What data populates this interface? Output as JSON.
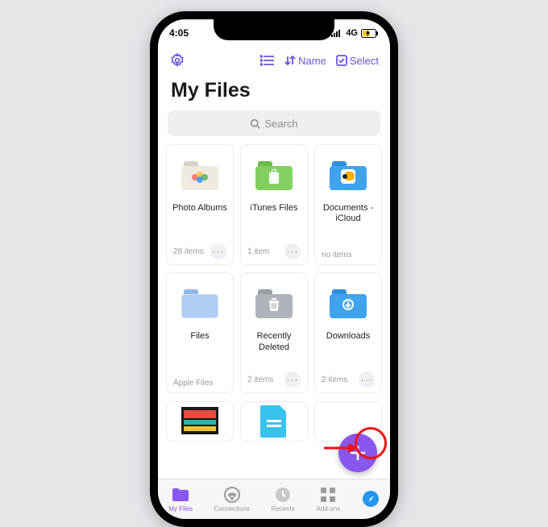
{
  "status": {
    "time": "4:05",
    "network": "4G"
  },
  "toolbar": {
    "sort_label": "Name",
    "select_label": "Select"
  },
  "header": {
    "title": "My Files"
  },
  "search": {
    "placeholder": "Search"
  },
  "tiles": [
    {
      "label": "Photo Albums",
      "count": "28 items",
      "has_more": true
    },
    {
      "label": "iTunes Files",
      "count": "1 item",
      "has_more": true
    },
    {
      "label": "Documents - iCloud",
      "count": "no items",
      "has_more": false
    },
    {
      "label": "Files",
      "count": "Apple Files",
      "has_more": false
    },
    {
      "label": "Recently Deleted",
      "count": "2 items",
      "has_more": true
    },
    {
      "label": "Downloads",
      "count": "2 items",
      "has_more": true
    }
  ],
  "tabs": [
    {
      "label": "My Files"
    },
    {
      "label": "Connections"
    },
    {
      "label": "Recents"
    },
    {
      "label": "Add-ons"
    },
    {
      "label": ""
    }
  ],
  "colors": {
    "accent": "#8a56f0",
    "link": "#6a55d8",
    "callout": "#e11"
  }
}
